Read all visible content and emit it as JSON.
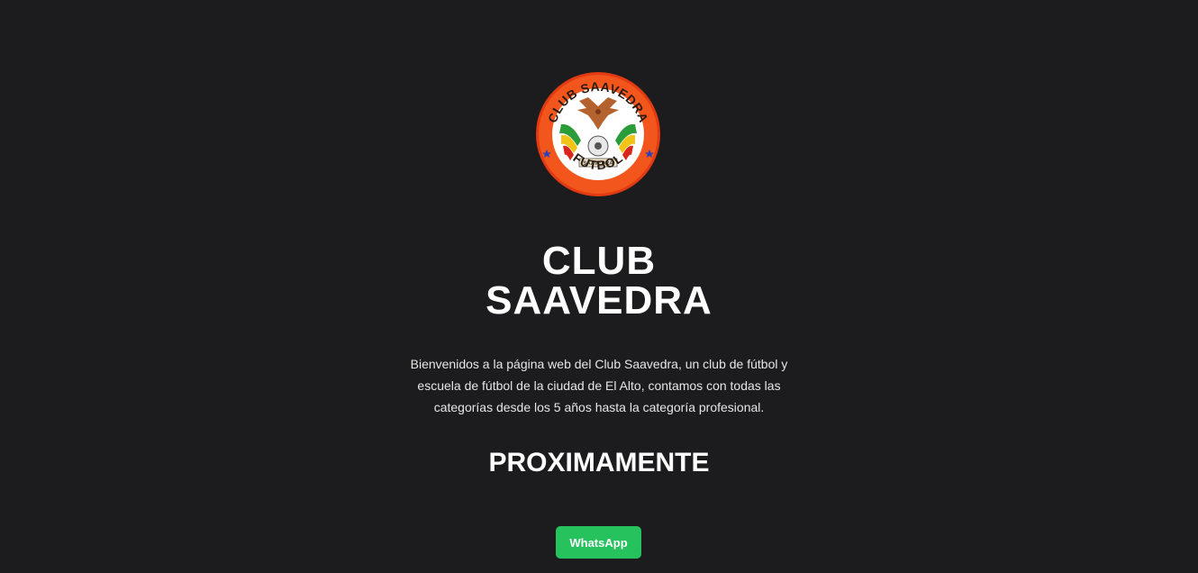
{
  "logo": {
    "ring_text_top": "CLUB SAAVEDRA",
    "ring_text_bottom": "FUTBOL",
    "banner_text": "SAAVEDRA",
    "colors": {
      "ring": "#f2561c",
      "ring_edge": "#e23a12",
      "inner": "#ffffff",
      "star": "#2a3fb8",
      "green": "#2a9c3a",
      "yellow": "#f2c418",
      "red": "#d9261c",
      "bird": "#b4622e"
    }
  },
  "hero": {
    "title_line1": "CLUB",
    "title_line2": "SAAVEDRA",
    "description": "Bienvenidos a la página web del Club Saavedra, un club de fútbol y escuela de fútbol de la ciudad de El Alto, contamos con todas las categorías desde los 5 años hasta la categoría profesional.",
    "coming_soon": "PROXIMAMENTE"
  },
  "cta": {
    "whatsapp_label": "WhatsApp",
    "color": "#25c25e"
  },
  "theme": {
    "background": "#1c1c1e",
    "text": "#ffffff"
  }
}
